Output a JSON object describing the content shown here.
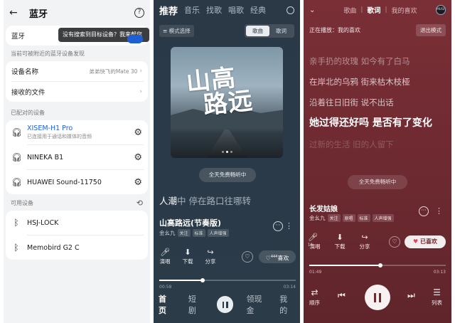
{
  "bluetooth": {
    "title": "蓝牙",
    "tooltip": "没有搜索到目标设备？我来帮您",
    "bt_label": "蓝牙",
    "discoverable_note": "当前可被附近的蓝牙设备发现",
    "device_name_label": "设备名称",
    "device_name_value": "弟弟快飞的Mate 30",
    "received_files_label": "接收的文件",
    "paired_header": "已配对的设备",
    "paired": [
      {
        "name": "XISEM-H1 Pro",
        "sub": "已连接用于通话和媒体的音频"
      },
      {
        "name": "NINEKA B1",
        "sub": ""
      },
      {
        "name": "HUAWEI Sound-11750",
        "sub": ""
      }
    ],
    "available_header": "可用设备",
    "available": [
      {
        "name": "HSJ-LOCK"
      },
      {
        "name": "Memobird G2 C"
      }
    ]
  },
  "player1": {
    "tabs": [
      "推荐",
      "音乐",
      "找歌",
      "唱歌",
      "经典"
    ],
    "mode_btn": "≡ 模式选择",
    "seg": [
      "歌曲",
      "歌词"
    ],
    "cover_text_1": "山高",
    "cover_text_2": "路远",
    "free_btn": "全天免费畅听中",
    "lyric_lead": "人潮",
    "lyric_rest": "中 停在路口往哪转",
    "song_title": "山高路远(节奏版)",
    "artist": "金幺九",
    "tags": [
      "关注",
      "标准",
      "人声增强"
    ],
    "actions": [
      "演唱",
      "下载",
      "分享"
    ],
    "fav": "喜欢",
    "fav_count": "444",
    "progress": 0.32,
    "time_current": "00:58",
    "time_total": "03:14",
    "nav": [
      "首页",
      "短剧",
      "领现金",
      "我的"
    ]
  },
  "player2": {
    "tabs": [
      "歌曲",
      "歌词",
      "我的喜欢"
    ],
    "logo": "MUSIC",
    "now_playing": "正在播放：我的喜欢",
    "exit_btn": "退出模式",
    "lyrics": [
      "亲手扔的玫瑰 如今有了白马",
      "在岸北的乌鸦 街来枯木枝桠",
      "沿着往日旧街 说不出话",
      "她过得还好吗 是否有了变化",
      "过新的生活 旧的人留下"
    ],
    "free_btn": "全天免费畅听中",
    "song_title": "长发姑娘",
    "artist": "金幺九",
    "tags": [
      "关注",
      "原唱",
      "标准",
      "人声增强"
    ],
    "actions": [
      "演唱",
      "下载",
      "分享"
    ],
    "action_badge": "14",
    "fav": "已喜欢",
    "progress": 0.52,
    "time_current": "01:49",
    "time_total": "03:13",
    "controls": [
      "顺序",
      "列表"
    ]
  },
  "colors": {
    "bt_accent": "#1f5fd6",
    "player1_bg": "#2b3947",
    "player2_bg": "#6e2a31",
    "fav_heart": "#e2455a"
  }
}
